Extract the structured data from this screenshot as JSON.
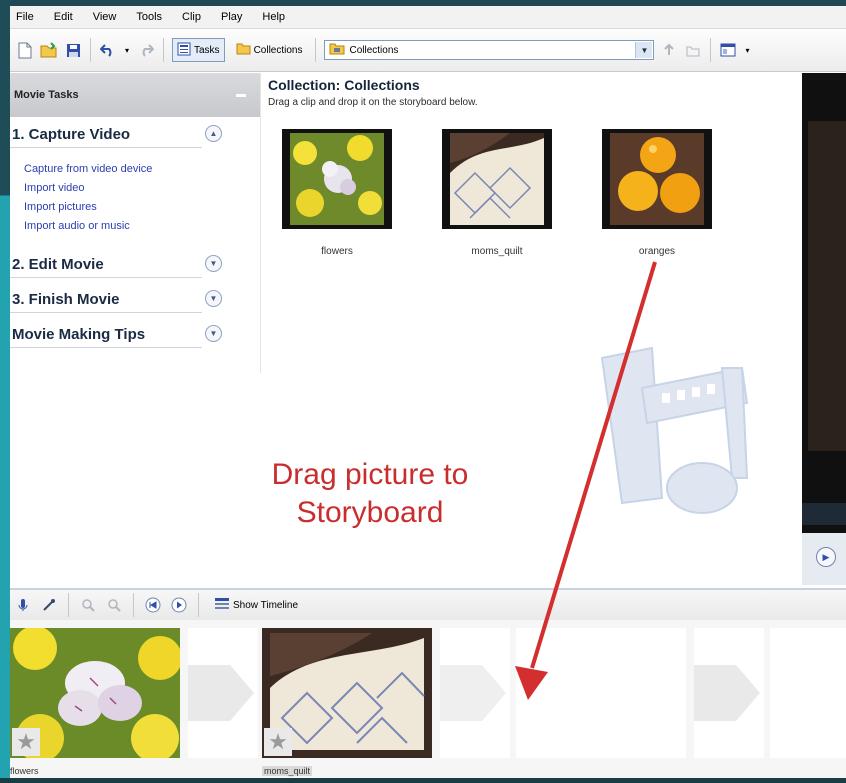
{
  "menu": [
    "File",
    "Edit",
    "View",
    "Tools",
    "Clip",
    "Play",
    "Help"
  ],
  "toolbar": {
    "tasks_label": "Tasks",
    "collections_label": "Collections",
    "dropdown_value": "Collections"
  },
  "tasks": {
    "header": "Movie Tasks",
    "sections": [
      {
        "label": "1. Capture Video",
        "expanded": true
      },
      {
        "label": "2. Edit Movie",
        "expanded": false
      },
      {
        "label": "3. Finish Movie",
        "expanded": false
      },
      {
        "label": "Movie Making Tips",
        "expanded": false
      }
    ],
    "capture_links": [
      "Capture from video device",
      "Import video",
      "Import pictures",
      "Import audio or music"
    ]
  },
  "collection": {
    "title": "Collection: Collections",
    "subtitle": "Drag a clip and drop it on the storyboard below.",
    "clips": [
      {
        "label": "flowers"
      },
      {
        "label": "moms_quilt"
      },
      {
        "label": "oranges"
      }
    ]
  },
  "overlay": {
    "line1": "Drag picture to",
    "line2": "Storyboard",
    "color": "#d32f2f"
  },
  "storyboard": {
    "show_timeline_label": "Show Timeline",
    "clips": [
      {
        "label": "flowers"
      },
      {
        "label": "moms_quilt"
      }
    ]
  },
  "colors": {
    "accent_link": "#2a3eb0",
    "frame_teal": "#23a2b0"
  }
}
